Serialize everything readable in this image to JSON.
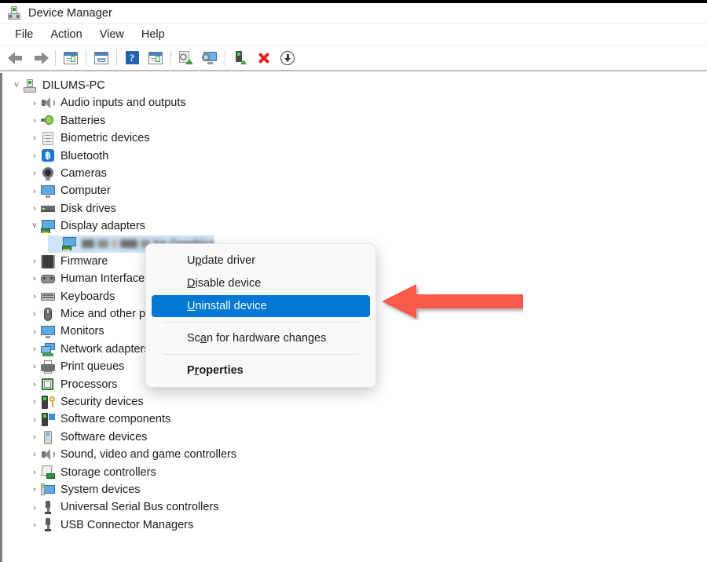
{
  "window": {
    "title": "Device Manager",
    "icon": "device-manager-icon"
  },
  "menubar": {
    "items": [
      {
        "label": "File"
      },
      {
        "label": "Action"
      },
      {
        "label": "View"
      },
      {
        "label": "Help"
      }
    ]
  },
  "toolbar": {
    "buttons": [
      {
        "icon": "back-arrow-icon",
        "tooltip": "Back"
      },
      {
        "icon": "forward-arrow-icon",
        "tooltip": "Forward"
      },
      {
        "icon": "show-hide-console-tree-icon",
        "tooltip": "Show/Hide Console Tree"
      },
      {
        "icon": "properties-icon",
        "tooltip": "Properties"
      },
      {
        "icon": "help-icon",
        "tooltip": "Help"
      },
      {
        "icon": "show-hide-action-pane-icon",
        "tooltip": "Show/Hide Action Pane"
      },
      {
        "icon": "update-driver-icon",
        "tooltip": "Update Driver Software"
      },
      {
        "icon": "scan-for-hardware-changes-icon",
        "tooltip": "Scan for hardware changes"
      },
      {
        "icon": "enable-device-icon",
        "tooltip": "Enable device"
      },
      {
        "icon": "uninstall-device-icon",
        "tooltip": "Uninstall device"
      },
      {
        "icon": "disable-device-icon",
        "tooltip": "Disable device"
      }
    ]
  },
  "tree": {
    "root": {
      "label": "DILUMS-PC",
      "icon": "computer-icon",
      "expanded": true,
      "chevron": "˅"
    },
    "items": [
      {
        "label": "Audio inputs and outputs",
        "icon": "speaker-icon",
        "chevron": "›",
        "level": 1
      },
      {
        "label": "Batteries",
        "icon": "battery-icon",
        "chevron": "›",
        "level": 1
      },
      {
        "label": "Biometric devices",
        "icon": "fingerprint-icon",
        "chevron": "›",
        "level": 1
      },
      {
        "label": "Bluetooth",
        "icon": "bluetooth-icon",
        "chevron": "›",
        "level": 1
      },
      {
        "label": "Cameras",
        "icon": "camera-icon",
        "chevron": "›",
        "level": 1
      },
      {
        "label": "Computer",
        "icon": "monitor-icon",
        "chevron": "›",
        "level": 1
      },
      {
        "label": "Disk drives",
        "icon": "disk-drive-icon",
        "chevron": "›",
        "level": 1
      },
      {
        "label": "Display adapters",
        "icon": "display-adapter-icon",
        "chevron": "˅",
        "level": 1,
        "expanded": true
      },
      {
        "label": "Firmware",
        "icon": "firmware-icon",
        "chevron": "›",
        "level": 1
      },
      {
        "label": "Human Interface Devices",
        "icon": "hid-icon",
        "chevron": "›",
        "level": 1
      },
      {
        "label": "Keyboards",
        "icon": "keyboard-icon",
        "chevron": "›",
        "level": 1
      },
      {
        "label": "Mice and other pointing devices",
        "icon": "mouse-icon",
        "chevron": "›",
        "level": 1
      },
      {
        "label": "Monitors",
        "icon": "monitor-icon",
        "chevron": "›",
        "level": 1
      },
      {
        "label": "Network adapters",
        "icon": "network-adapter-icon",
        "chevron": "›",
        "level": 1
      },
      {
        "label": "Print queues",
        "icon": "printer-icon",
        "chevron": "›",
        "level": 1
      },
      {
        "label": "Processors",
        "icon": "processor-icon",
        "chevron": "›",
        "level": 1
      },
      {
        "label": "Security devices",
        "icon": "security-device-icon",
        "chevron": "›",
        "level": 1
      },
      {
        "label": "Software components",
        "icon": "software-component-icon",
        "chevron": "›",
        "level": 1
      },
      {
        "label": "Software devices",
        "icon": "software-device-icon",
        "chevron": "›",
        "level": 1
      },
      {
        "label": "Sound, video and game controllers",
        "icon": "speaker-icon",
        "chevron": "›",
        "level": 1
      },
      {
        "label": "Storage controllers",
        "icon": "storage-controller-icon",
        "chevron": "›",
        "level": 1
      },
      {
        "label": "System devices",
        "icon": "system-device-icon",
        "chevron": "›",
        "level": 1
      },
      {
        "label": "Universal Serial Bus controllers",
        "icon": "usb-icon",
        "chevron": "›",
        "level": 1
      },
      {
        "label": "USB Connector Managers",
        "icon": "usb-icon",
        "chevron": "›",
        "level": 1
      }
    ],
    "selected_device": {
      "label_visible": "Xe Graphics",
      "label_redacted": true,
      "icon": "display-adapter-icon",
      "selected": true
    }
  },
  "context_menu": {
    "items": [
      {
        "label": "Update driver",
        "accel": "p",
        "highlighted": false,
        "bold": false
      },
      {
        "label": "Disable device",
        "accel": "D",
        "highlighted": false,
        "bold": false
      },
      {
        "label": "Uninstall device",
        "accel": "U",
        "highlighted": true,
        "bold": false
      },
      {
        "label": "Scan for hardware changes",
        "accel": "a",
        "highlighted": false,
        "bold": false
      },
      {
        "label": "Properties",
        "accel": "r",
        "highlighted": false,
        "bold": true
      }
    ]
  },
  "annotation": {
    "arrow": {
      "name": "red-pointer-arrow",
      "direction": "left",
      "color": "#fa5a4b"
    }
  },
  "colors": {
    "accent_blue": "#0078d4",
    "selection_blue": "#cfe4f7",
    "arrow_red": "#fa5a4b",
    "window_bg": "#ffffff",
    "menu_bg": "#f9f9f9"
  }
}
